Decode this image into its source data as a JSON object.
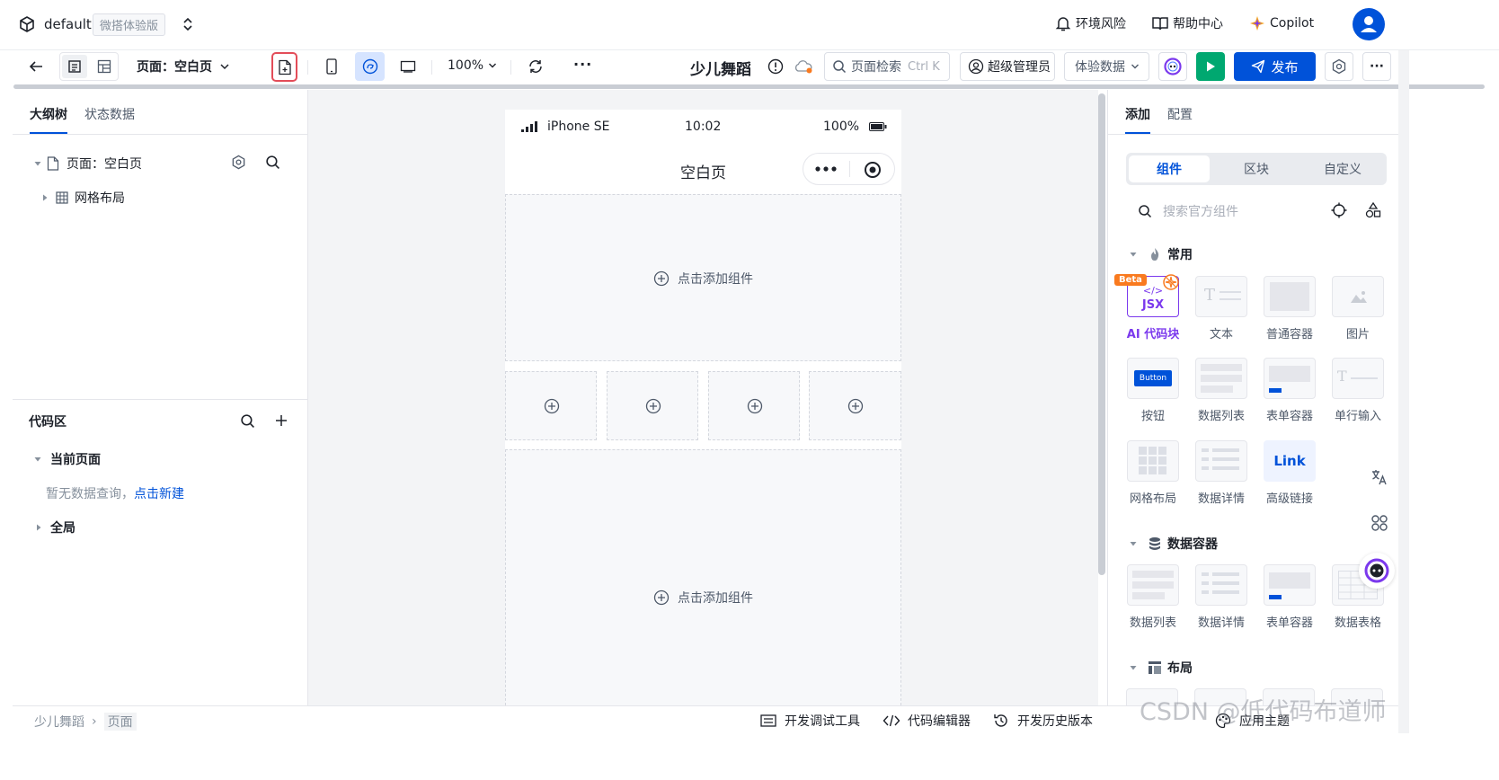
{
  "topbar": {
    "workspace": "default",
    "edition_badge": "微搭体验版",
    "env_risk": "环境风险",
    "help": "帮助中心",
    "copilot": "Copilot"
  },
  "toolbar": {
    "page_selector": "页面：空白页",
    "zoom": "100%",
    "app_name": "少儿舞蹈",
    "search_placeholder": "页面检索",
    "search_shortcut": "Ctrl K",
    "admin": "超级管理员",
    "data_mode": "体验数据",
    "publish": "发布",
    "more": "···"
  },
  "left": {
    "tabs": [
      "大纲树",
      "状态数据"
    ],
    "tree": {
      "page": "页面：空白页",
      "grid": "网格布局"
    },
    "code": {
      "title": "代码区",
      "current_page": "当前页面",
      "empty_text": "暂无数据查询，",
      "create_link": "点击新建",
      "global": "全局"
    }
  },
  "phone": {
    "device": "iPhone SE",
    "time": "10:02",
    "battery": "100%",
    "page_title": "空白页",
    "add_component": "点击添加组件"
  },
  "right": {
    "tabs": [
      "添加",
      "配置"
    ],
    "segments": [
      "组件",
      "区块",
      "自定义"
    ],
    "search_placeholder": "搜索官方组件",
    "sections": {
      "common": "常用",
      "data_container": "数据容器",
      "layout": "布局"
    },
    "common_items": [
      "AI 代码块",
      "文本",
      "普通容器",
      "图片",
      "按钮",
      "数据列表",
      "表单容器",
      "单行输入",
      "网格布局",
      "数据详情",
      "高级链接"
    ],
    "data_items": [
      "数据列表",
      "数据详情",
      "表单容器",
      "数据表格"
    ],
    "beta_badge": "Beta",
    "jsx_label": "JSX",
    "button_label": "Button",
    "link_label": "Link"
  },
  "bottom": {
    "breadcrumb": [
      "少儿舞蹈",
      "页面"
    ],
    "dev_tools": "开发调试工具",
    "code_editor": "代码编辑器",
    "history": "开发历史版本",
    "theme": "应用主题"
  },
  "watermark": "CSDN @低代码布道师",
  "colors": {
    "primary": "#0052d9",
    "publish_bg": "#0052d9",
    "run_bg": "#00a870",
    "ai_purple": "#7b39ed",
    "beta_orange": "#f97a1f",
    "highlight_red": "#e34d59"
  }
}
